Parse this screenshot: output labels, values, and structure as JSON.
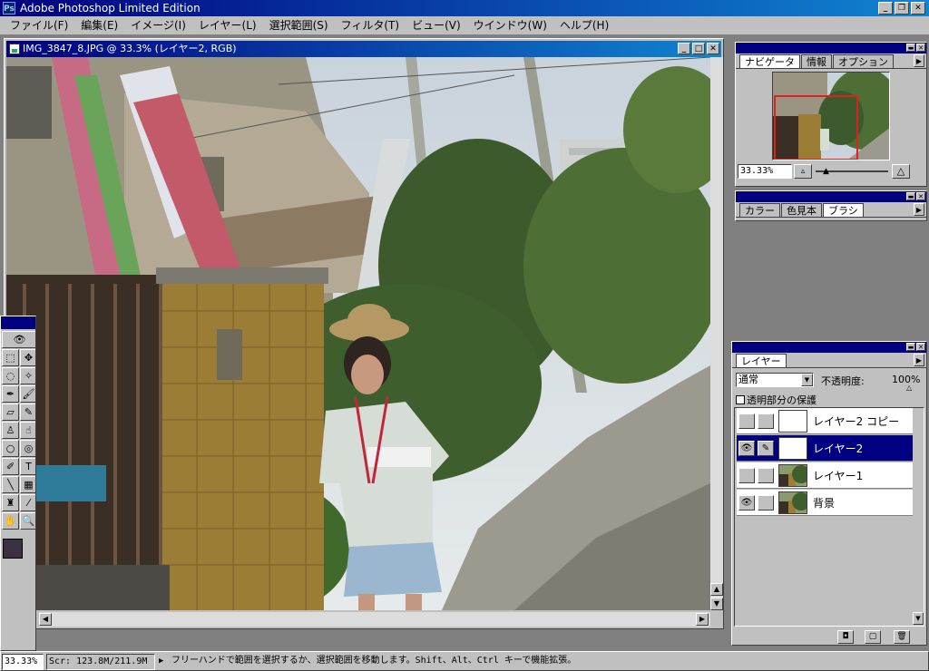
{
  "app": {
    "title": "Adobe Photoshop Limited Edition"
  },
  "menu": [
    "ファイル(F)",
    "編集(E)",
    "イメージ(I)",
    "レイヤー(L)",
    "選択範囲(S)",
    "フィルタ(T)",
    "ビュー(V)",
    "ウインドウ(W)",
    "ヘルプ(H)"
  ],
  "document": {
    "title": "IMG_3847_8.JPG @ 33.3% (レイヤー2, RGB)"
  },
  "navigator": {
    "tabs": [
      "ナビゲータ",
      "情報",
      "オプション"
    ],
    "zoom_value": "33.33%"
  },
  "color_palette": {
    "tabs": [
      "カラー",
      "色見本",
      "ブラシ"
    ]
  },
  "layers": {
    "tab": "レイヤー",
    "blend_mode": "通常",
    "opacity_label": "不透明度:",
    "opacity_value": "100%",
    "preserve_label": "透明部分の保護",
    "rows": [
      {
        "name": "レイヤー2 コピー",
        "visible": false,
        "editing": false,
        "selected": false
      },
      {
        "name": "レイヤー2",
        "visible": true,
        "editing": true,
        "selected": true
      },
      {
        "name": "レイヤー1",
        "visible": false,
        "editing": false,
        "selected": false
      },
      {
        "name": "背景",
        "visible": true,
        "editing": false,
        "selected": false
      }
    ]
  },
  "status": {
    "zoom": "33.33%",
    "doc_size": "Scr: 123.8M/211.9M",
    "hint": "フリーハンドで範囲を選択するか、選択範囲を移動します。Shift、Alt、Ctrl キーで機能拡張。"
  },
  "colors": {
    "title_blue": "#000080",
    "chrome": "#c0c0c0",
    "workspace": "#808080",
    "nav_rect": "#e02020"
  }
}
